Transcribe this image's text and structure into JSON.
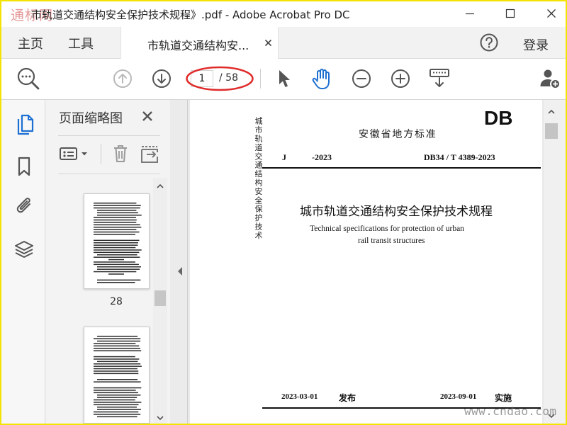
{
  "window": {
    "watermark_logo": "通标网",
    "title": "市轨道交通结构安全保护技术规程》.pdf - Adobe Acrobat Pro DC"
  },
  "menu": {
    "home": "主页",
    "tools": "工具",
    "document_tab": "市轨道交通结构安...",
    "login": "登录"
  },
  "toolbar": {
    "page_current": "1",
    "page_total": "/ 58"
  },
  "thumbnails_panel": {
    "title": "页面缩略图",
    "pages": [
      {
        "label": "28"
      },
      {
        "label": ""
      }
    ]
  },
  "document": {
    "spine_title": "城市轨道交通结构安全保护技术",
    "db_mark": "DB",
    "authority": "安徽省地方标准",
    "j_code": "J",
    "j_year": "-2023",
    "standard_number": "DB34 / T 4389-2023",
    "title_cn": "城市轨道交通结构安全保护技术规程",
    "title_en_line1": "Technical specifications for protection of urban",
    "title_en_line2": "rail transit structures",
    "release_date": "2023-03-01",
    "release_label": "发布",
    "implement_date": "2023-09-01",
    "implement_label": "实施"
  },
  "site_watermark": "www.cndao.com",
  "icons": {
    "title_bar": [
      "minimize-icon",
      "maximize-icon",
      "close-icon"
    ],
    "menu_bar": [
      "tab-close-icon",
      "help-icon"
    ],
    "toolbar": [
      "find-icon",
      "previous-page-icon",
      "next-page-icon",
      "select-cursor-icon",
      "hand-tool-icon",
      "zoom-out-icon",
      "zoom-in-icon",
      "marquee-zoom-icon",
      "share-user-icon"
    ],
    "left_rail": [
      "page-thumbnails-icon",
      "bookmarks-icon",
      "attachments-icon",
      "layers-icon"
    ],
    "thumbnail_toolbar": [
      "thumbnail-options-icon",
      "delete-page-icon",
      "extract-pages-icon"
    ],
    "panel": [
      "panel-close-icon",
      "collapse-panel-icon"
    ]
  },
  "colors": {
    "accent_blue": "#1d6fd1",
    "annotation_red": "#e02b2b",
    "frame_yellow": "#f3e300",
    "disabled_gray": "#b9b9b9"
  }
}
